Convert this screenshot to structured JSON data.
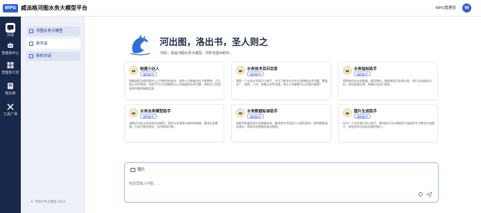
{
  "app": {
    "logo_text": "WPG",
    "title": "威派格河图水务大模型平台",
    "user_name": "WPG管理员",
    "user_initial": "W"
  },
  "leftnav": {
    "items": [
      {
        "label": "对话",
        "icon": "chat-icon",
        "active": true
      },
      {
        "label": "智能体中心",
        "icon": "agent-icon",
        "active": false
      },
      {
        "label": "智能体工坊",
        "icon": "workshop-icon",
        "active": false
      },
      {
        "label": "知识库",
        "icon": "knowledge-icon",
        "active": false
      },
      {
        "label": "工具广场",
        "icon": "tools-icon",
        "active": false
      }
    ]
  },
  "sidepanel": {
    "items": [
      {
        "label": "河图水务大模型",
        "style": "sel"
      },
      {
        "label": "新对话",
        "style": "white"
      },
      {
        "label": "新的对话",
        "style": "sel"
      }
    ],
    "copyright": "© 河图水务大模型 2024"
  },
  "hero": {
    "title": "河出图，洛出书，圣人则之",
    "subtitle": "你好，我是河图水务大模型，你的全能AI助手。"
  },
  "cards": [
    {
      "title": "制度小达人",
      "tag": "通用助手",
      "desc": "随着政策法规的更迭与工作细节的变化，各种公司制度也在不断更新，员工难以及时获知。本助手可以为您解答与公司制度相关的问题，帮助员工快速获取所需的制度信息。"
    },
    {
      "title": "水务技术百问百答",
      "tag": "通用助手",
      "desc": "我是一个水务技术知识小助手，专注于解决水务专业领域的技术问题。覆盖水厂、管网、二供、智慧水务等领域，有什么问题都可以尽管问我哦！"
    },
    {
      "title": "水务指标助手",
      "tag": "通用助手",
      "desc": "提取和分析业务数据，解读指标，精准制定目标和计划，进行水务指标分析，助您高效运营，保障水务运行稳定。"
    },
    {
      "title": "水务业务模型助手",
      "tag": "通用助手",
      "desc": "调取并分析水务系统业务模型，提供业务逻辑与结构的梳理，解读业务数据，生成可视化报告，支持高效决策。"
    },
    {
      "title": "水务数据标准助手",
      "tag": "通用助手",
      "desc": "调取并查看各类水务数据标准，解读其中字段定义与规范要求，提供数据清洗建议，帮助实现数据标准化管理。"
    },
    {
      "title": "图片生成助手",
      "tag": "通用助手",
      "desc": "作为一个文生图片的小助手，我的能力可以按照用户描述的文字需求生成图片，助您创作出具有创意的图片。"
    }
  ],
  "input": {
    "image_label": "图片",
    "placeholder": "给这里输入问题……"
  },
  "colors": {
    "accent": "#2f5fd6",
    "nav_bg": "#17284a",
    "page_bg": "#eef1f7"
  }
}
